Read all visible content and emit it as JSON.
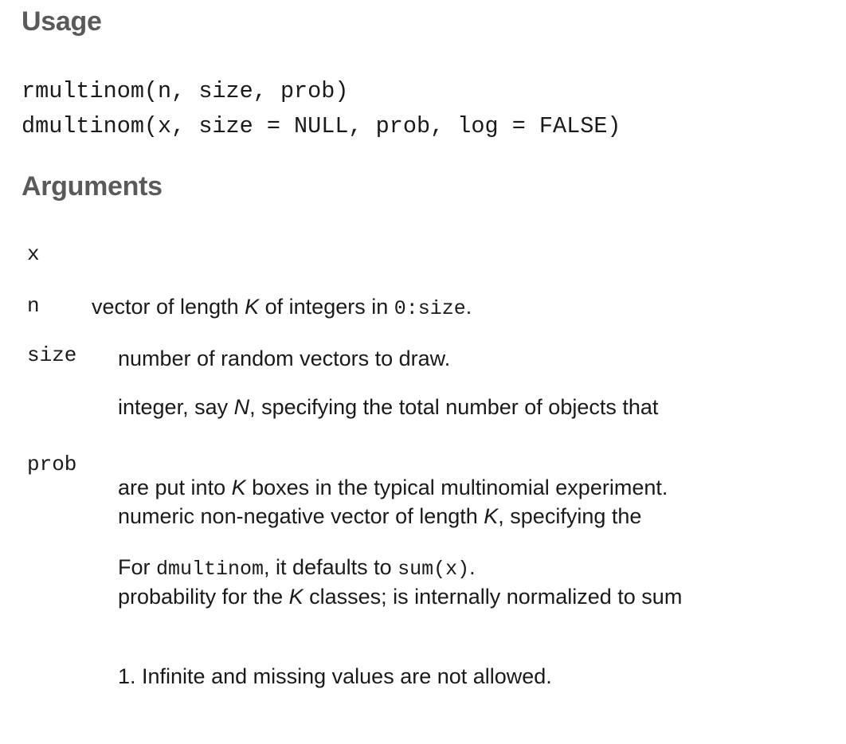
{
  "usage": {
    "heading": "Usage",
    "lines": [
      "rmultinom(n, size, prob)",
      "dmultinom(x, size = NULL, prob, log = FALSE)"
    ]
  },
  "arguments": {
    "heading": "Arguments",
    "items": [
      {
        "name": "x",
        "desc": {
          "t1": "vector of length ",
          "k": "K",
          "t2": " of integers in ",
          "code": "0:size",
          "t3": "."
        }
      },
      {
        "name": "n",
        "desc": {
          "t1": "number of random vectors to draw."
        }
      },
      {
        "name": "size",
        "desc": {
          "l1_t1": "integer, say ",
          "l1_n": "N",
          "l1_t2": ", specifying the total number of objects that",
          "l2_t1": "are put into ",
          "l2_k": "K",
          "l2_t2": " boxes in the typical multinomial experiment.",
          "l3_t1": "For ",
          "l3_code1": "dmultinom",
          "l3_t2": ", it defaults to ",
          "l3_code2": "sum(x)",
          "l3_t3": "."
        }
      },
      {
        "name": "prob",
        "desc": {
          "l1_t1": "numeric non-negative vector of length ",
          "l1_k": "K",
          "l1_t2": ", specifying the",
          "l2_t1": "probability for the ",
          "l2_k": "K",
          "l2_t2": " classes; is internally normalized to sum",
          "l3_t1": "1. Infinite and missing values are not allowed."
        }
      }
    ]
  }
}
